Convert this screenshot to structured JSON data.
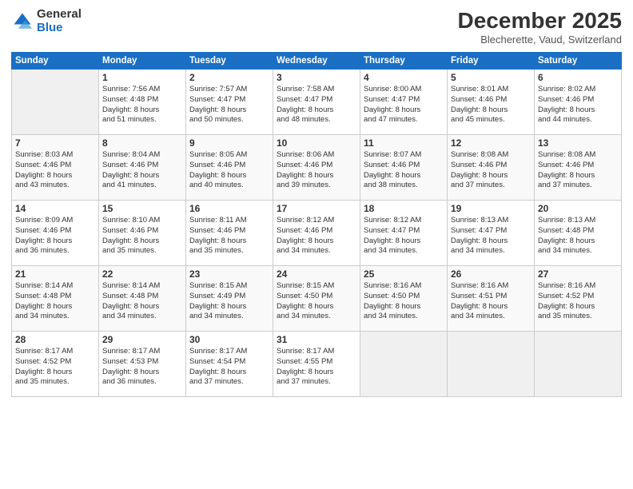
{
  "logo": {
    "line1": "General",
    "line2": "Blue"
  },
  "title": "December 2025",
  "subtitle": "Blecherette, Vaud, Switzerland",
  "days_of_week": [
    "Sunday",
    "Monday",
    "Tuesday",
    "Wednesday",
    "Thursday",
    "Friday",
    "Saturday"
  ],
  "weeks": [
    [
      {
        "day": "",
        "info": ""
      },
      {
        "day": "1",
        "info": "Sunrise: 7:56 AM\nSunset: 4:48 PM\nDaylight: 8 hours\nand 51 minutes."
      },
      {
        "day": "2",
        "info": "Sunrise: 7:57 AM\nSunset: 4:47 PM\nDaylight: 8 hours\nand 50 minutes."
      },
      {
        "day": "3",
        "info": "Sunrise: 7:58 AM\nSunset: 4:47 PM\nDaylight: 8 hours\nand 48 minutes."
      },
      {
        "day": "4",
        "info": "Sunrise: 8:00 AM\nSunset: 4:47 PM\nDaylight: 8 hours\nand 47 minutes."
      },
      {
        "day": "5",
        "info": "Sunrise: 8:01 AM\nSunset: 4:46 PM\nDaylight: 8 hours\nand 45 minutes."
      },
      {
        "day": "6",
        "info": "Sunrise: 8:02 AM\nSunset: 4:46 PM\nDaylight: 8 hours\nand 44 minutes."
      }
    ],
    [
      {
        "day": "7",
        "info": "Sunrise: 8:03 AM\nSunset: 4:46 PM\nDaylight: 8 hours\nand 43 minutes."
      },
      {
        "day": "8",
        "info": "Sunrise: 8:04 AM\nSunset: 4:46 PM\nDaylight: 8 hours\nand 41 minutes."
      },
      {
        "day": "9",
        "info": "Sunrise: 8:05 AM\nSunset: 4:46 PM\nDaylight: 8 hours\nand 40 minutes."
      },
      {
        "day": "10",
        "info": "Sunrise: 8:06 AM\nSunset: 4:46 PM\nDaylight: 8 hours\nand 39 minutes."
      },
      {
        "day": "11",
        "info": "Sunrise: 8:07 AM\nSunset: 4:46 PM\nDaylight: 8 hours\nand 38 minutes."
      },
      {
        "day": "12",
        "info": "Sunrise: 8:08 AM\nSunset: 4:46 PM\nDaylight: 8 hours\nand 37 minutes."
      },
      {
        "day": "13",
        "info": "Sunrise: 8:08 AM\nSunset: 4:46 PM\nDaylight: 8 hours\nand 37 minutes."
      }
    ],
    [
      {
        "day": "14",
        "info": "Sunrise: 8:09 AM\nSunset: 4:46 PM\nDaylight: 8 hours\nand 36 minutes."
      },
      {
        "day": "15",
        "info": "Sunrise: 8:10 AM\nSunset: 4:46 PM\nDaylight: 8 hours\nand 35 minutes."
      },
      {
        "day": "16",
        "info": "Sunrise: 8:11 AM\nSunset: 4:46 PM\nDaylight: 8 hours\nand 35 minutes."
      },
      {
        "day": "17",
        "info": "Sunrise: 8:12 AM\nSunset: 4:46 PM\nDaylight: 8 hours\nand 34 minutes."
      },
      {
        "day": "18",
        "info": "Sunrise: 8:12 AM\nSunset: 4:47 PM\nDaylight: 8 hours\nand 34 minutes."
      },
      {
        "day": "19",
        "info": "Sunrise: 8:13 AM\nSunset: 4:47 PM\nDaylight: 8 hours\nand 34 minutes."
      },
      {
        "day": "20",
        "info": "Sunrise: 8:13 AM\nSunset: 4:48 PM\nDaylight: 8 hours\nand 34 minutes."
      }
    ],
    [
      {
        "day": "21",
        "info": "Sunrise: 8:14 AM\nSunset: 4:48 PM\nDaylight: 8 hours\nand 34 minutes."
      },
      {
        "day": "22",
        "info": "Sunrise: 8:14 AM\nSunset: 4:48 PM\nDaylight: 8 hours\nand 34 minutes."
      },
      {
        "day": "23",
        "info": "Sunrise: 8:15 AM\nSunset: 4:49 PM\nDaylight: 8 hours\nand 34 minutes."
      },
      {
        "day": "24",
        "info": "Sunrise: 8:15 AM\nSunset: 4:50 PM\nDaylight: 8 hours\nand 34 minutes."
      },
      {
        "day": "25",
        "info": "Sunrise: 8:16 AM\nSunset: 4:50 PM\nDaylight: 8 hours\nand 34 minutes."
      },
      {
        "day": "26",
        "info": "Sunrise: 8:16 AM\nSunset: 4:51 PM\nDaylight: 8 hours\nand 34 minutes."
      },
      {
        "day": "27",
        "info": "Sunrise: 8:16 AM\nSunset: 4:52 PM\nDaylight: 8 hours\nand 35 minutes."
      }
    ],
    [
      {
        "day": "28",
        "info": "Sunrise: 8:17 AM\nSunset: 4:52 PM\nDaylight: 8 hours\nand 35 minutes."
      },
      {
        "day": "29",
        "info": "Sunrise: 8:17 AM\nSunset: 4:53 PM\nDaylight: 8 hours\nand 36 minutes."
      },
      {
        "day": "30",
        "info": "Sunrise: 8:17 AM\nSunset: 4:54 PM\nDaylight: 8 hours\nand 37 minutes."
      },
      {
        "day": "31",
        "info": "Sunrise: 8:17 AM\nSunset: 4:55 PM\nDaylight: 8 hours\nand 37 minutes."
      },
      {
        "day": "",
        "info": ""
      },
      {
        "day": "",
        "info": ""
      },
      {
        "day": "",
        "info": ""
      }
    ]
  ]
}
